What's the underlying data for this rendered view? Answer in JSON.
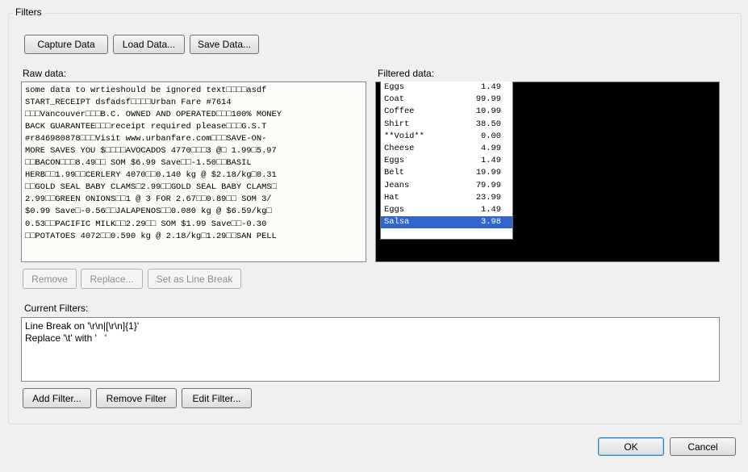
{
  "group_title": "Filters",
  "buttons": {
    "capture": "Capture Data",
    "load": "Load Data...",
    "save": "Save Data...",
    "remove": "Remove",
    "replace": "Replace...",
    "set_line_break": "Set as Line Break",
    "add_filter": "Add Filter...",
    "remove_filter": "Remove Filter",
    "edit_filter": "Edit Filter...",
    "ok": "OK",
    "cancel": "Cancel"
  },
  "raw": {
    "label": "Raw data:",
    "lines": [
      "some data to wrtieshould be ignored text□□□□asdf",
      "START_RECEIPT dsfadsf□□□□Urban Fare #7614",
      "□□□Vancouver□□□B.C. OWNED AND OPERATED□□□100% MONEY",
      "BACK GUARANTEE□□□receipt required please□□□G.S.T",
      "#r846980878□□□Visit www.urbanfare.com□□□SAVE-ON-",
      "MORE SAVES YOU $□□□□AVOCADOS 4770□□□3 @□ 1.99□5.97",
      "□□BACON□□□8.49□□ SOM $6.99 Save□□-1.50□□BASIL",
      "HERB□□1.99□□CERLERY 4070□□0.140 kg @ $2.18/kg□0.31",
      "□□GOLD SEAL BABY CLAMS□2.99□□GOLD SEAL BABY CLAMS□",
      "2.99□□GREEN ONIONS□□1 @ 3 FOR 2.67□□0.89□□ SOM 3/",
      "$0.99 Save□-0.56□□JALAPENOS□□0.080 kg @ $6.59/kg□",
      "0.53□□PACIFIC MILK□□2.29□□ SOM $1.99 Save□□-0.30",
      "□□POTATOES 4072□□0.590 kg @ 2.18/kg□1.29□□SAN PELL"
    ]
  },
  "filtered": {
    "label": "Filtered data:",
    "rows": [
      {
        "name": "Eggs",
        "price": "1.49"
      },
      {
        "name": "Coat",
        "price": "99.99"
      },
      {
        "name": "Coffee",
        "price": "10.99"
      },
      {
        "name": "Shirt",
        "price": "38.50"
      },
      {
        "name": "**Void**",
        "price": "0.00"
      },
      {
        "name": "Cheese",
        "price": "4.99"
      },
      {
        "name": "Eggs",
        "price": "1.49"
      },
      {
        "name": "Belt",
        "price": "19.99"
      },
      {
        "name": "Jeans",
        "price": "79.99"
      },
      {
        "name": "Hat",
        "price": "23.99"
      },
      {
        "name": "Eggs",
        "price": "1.49"
      },
      {
        "name": "Salsa",
        "price": "3.98"
      }
    ],
    "selected_index": 11
  },
  "current_filters": {
    "label": "Current Filters:",
    "items": [
      "Line Break on '\\r\\n|[\\r\\n]{1}'",
      "Replace '\\t' with '   '"
    ]
  }
}
